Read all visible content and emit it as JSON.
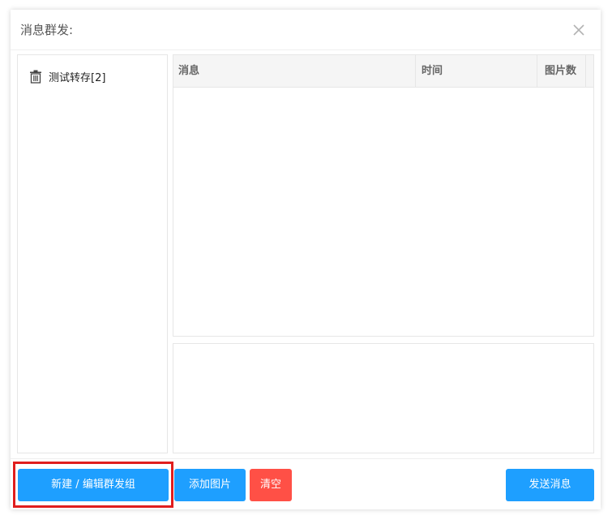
{
  "dialog": {
    "title": "消息群发:",
    "close_icon": "close-icon"
  },
  "groups": {
    "items": [
      {
        "label": "测试转存[2]",
        "icon": "trash-icon"
      }
    ]
  },
  "table": {
    "columns": [
      "消息",
      "时间",
      "图片数"
    ],
    "rows": []
  },
  "message_input": {
    "value": ""
  },
  "buttons": {
    "new_edit_group": "新建 / 编辑群发组",
    "add_image": "添加图片",
    "clear": "清空",
    "send": "发送消息"
  },
  "colors": {
    "primary": "#1e9fff",
    "danger": "#ff5046",
    "highlight": "#e01e1e"
  }
}
